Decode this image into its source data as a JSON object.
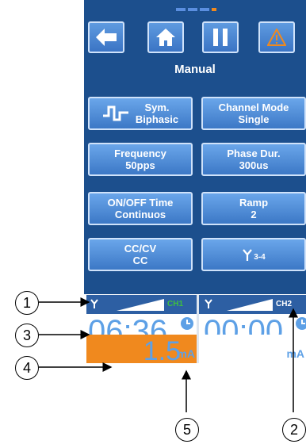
{
  "nav": {
    "back_icon": "arrow-left-icon",
    "home_icon": "home-icon",
    "pause_icon": "pause-icon",
    "warning_icon": "warning-triangle-icon"
  },
  "screen_title": "Manual",
  "tiles": [
    {
      "name": "waveform-tile",
      "line1": "Sym.",
      "line2": "Biphasic"
    },
    {
      "name": "channel-mode-tile",
      "line1": "Channel Mode",
      "line2": "Single"
    },
    {
      "name": "frequency-tile",
      "line1": "Frequency",
      "line2": "50pps"
    },
    {
      "name": "phase-duration-tile",
      "line1": "Phase Dur.",
      "line2": "300us"
    },
    {
      "name": "on-off-time-tile",
      "line1": "ON/OFF Time",
      "line2": "Continuos"
    },
    {
      "name": "ramp-tile",
      "line1": "Ramp",
      "line2": "2"
    },
    {
      "name": "cc-cv-tile",
      "line1": "CC/CV",
      "line2": "CC"
    },
    {
      "name": "electrode-split-tile",
      "line1": "3-4"
    }
  ],
  "channels": [
    {
      "label": "CH1",
      "timer": "06:36",
      "current_value": "1.5",
      "current_unit": "mA"
    },
    {
      "label": "CH2",
      "timer": "00:00",
      "current_value": "",
      "current_unit": "mA"
    }
  ],
  "callouts": [
    "1",
    "2",
    "3",
    "4",
    "5"
  ],
  "colors": {
    "screen_bg": "#1c4f8d",
    "button_blue": "#4a88d6",
    "channel_bar": "#2d5fa3",
    "active_channel_green": "#3fbf3f",
    "current_orange": "#f0891e",
    "timer_blue": "#5da0e6",
    "warning_orange": "#f0891e"
  }
}
